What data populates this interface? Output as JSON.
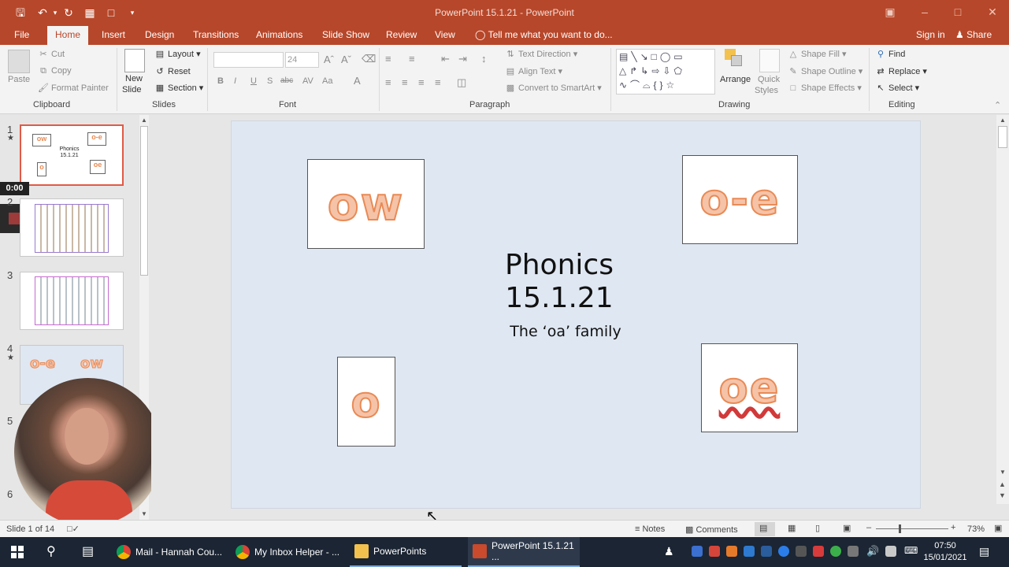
{
  "window": {
    "title": "PowerPoint 15.1.21 - PowerPoint"
  },
  "tabs": [
    "File",
    "Home",
    "Insert",
    "Design",
    "Transitions",
    "Animations",
    "Slide Show",
    "Review",
    "View"
  ],
  "tell_me": "Tell me what you want to do...",
  "account": {
    "sign_in": "Sign in",
    "share": "Share"
  },
  "clipboard": {
    "paste": "Paste",
    "cut": "Cut",
    "copy": "Copy",
    "format_painter": "Format Painter",
    "label": "Clipboard"
  },
  "slides_group": {
    "new_slide": "New",
    "new_slide2": "Slide",
    "layout": "Layout",
    "reset": "Reset",
    "section": "Section",
    "label": "Slides"
  },
  "font_group": {
    "size": "24",
    "label": "Font",
    "bold": "B",
    "italic": "I",
    "underline": "U",
    "shadow": "S",
    "strike": "abc"
  },
  "paragraph_group": {
    "text_direction": "Text Direction",
    "align_text": "Align Text",
    "convert_smartart": "Convert to SmartArt",
    "label": "Paragraph"
  },
  "drawing_group": {
    "arrange": "Arrange",
    "quick_styles": "Quick",
    "quick_styles2": "Styles",
    "shape_fill": "Shape Fill",
    "shape_outline": "Shape Outline",
    "shape_effects": "Shape Effects",
    "label": "Drawing"
  },
  "editing_group": {
    "find": "Find",
    "replace": "Replace",
    "select": "Select",
    "label": "Editing"
  },
  "slide_numbers": [
    "1",
    "2",
    "3",
    "4",
    "5",
    "6"
  ],
  "webcam_timer": "0:00",
  "thumb1": {
    "t1": "Phonics",
    "t2": "15.1.21"
  },
  "thumb4": {
    "a": "o-e",
    "b": "ow"
  },
  "slide": {
    "cards": {
      "ow": "ow",
      "oe_split": "o-e",
      "o": "o",
      "oe": "oe"
    },
    "title_line1": "Phonics",
    "title_line2": "15.1.21",
    "subtitle": "The ‘oa’ family"
  },
  "status": {
    "slide_of": "Slide 1 of 14",
    "notes": "Notes",
    "comments": "Comments",
    "zoom": "73%"
  },
  "taskbar": {
    "items": [
      "Mail - Hannah Cou...",
      "My Inbox Helper - ...",
      "PowerPoints",
      "PowerPoint 15.1.21 ..."
    ],
    "time": "07:50",
    "date": "15/01/2021"
  },
  "colors": {
    "accent": "#b7472a",
    "letter_fill": "#f5c3a8",
    "letter_stroke": "#e98a55",
    "slide_bg": "#dfe7f2",
    "taskbar": "#1b2533"
  }
}
